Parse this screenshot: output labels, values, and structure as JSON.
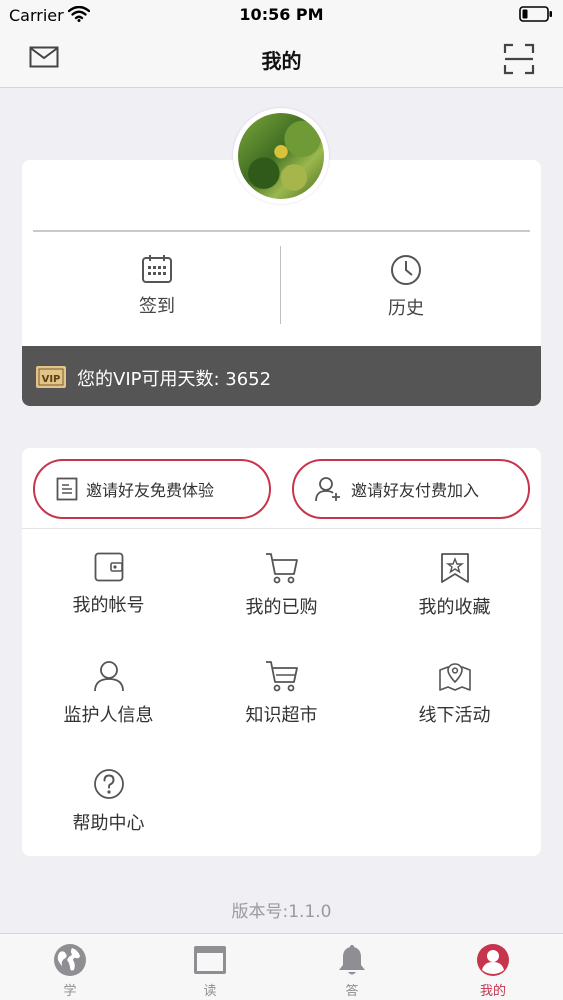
{
  "status_bar": {
    "carrier": "Carrier",
    "time": "10:56 PM"
  },
  "nav": {
    "title": "我的",
    "left_icon": "mail-icon",
    "right_icon": "scan-icon"
  },
  "profile": {
    "actions": [
      {
        "label": "签到",
        "icon": "calendar-icon"
      },
      {
        "label": "历史",
        "icon": "clock-icon"
      }
    ],
    "vip": {
      "badge": "VIP",
      "text": "您的VIP可用天数: 3652"
    }
  },
  "invite": [
    {
      "label": "邀请好友免费体验",
      "icon": "document-icon"
    },
    {
      "label": "邀请好友付费加入",
      "icon": "add-user-icon"
    }
  ],
  "menu": [
    {
      "label": "我的帐号",
      "icon": "wallet-icon"
    },
    {
      "label": "我的已购",
      "icon": "cart-icon"
    },
    {
      "label": "我的收藏",
      "icon": "bookmark-star-icon"
    },
    {
      "label": "监护人信息",
      "icon": "person-icon"
    },
    {
      "label": "知识超市",
      "icon": "shopping-cart-icon"
    },
    {
      "label": "线下活动",
      "icon": "map-pin-icon"
    },
    {
      "label": "帮助中心",
      "icon": "help-icon"
    }
  ],
  "version": "版本号:1.1.0",
  "tabs": [
    {
      "label": "学",
      "icon": "globe-icon",
      "active": false
    },
    {
      "label": "读",
      "icon": "browser-icon",
      "active": false
    },
    {
      "label": "答",
      "icon": "bell-icon",
      "active": false
    },
    {
      "label": "我的",
      "icon": "profile-icon",
      "active": true
    }
  ],
  "colors": {
    "accent": "#c7354d",
    "vip_bar": "#555555",
    "background": "#efeff4"
  }
}
